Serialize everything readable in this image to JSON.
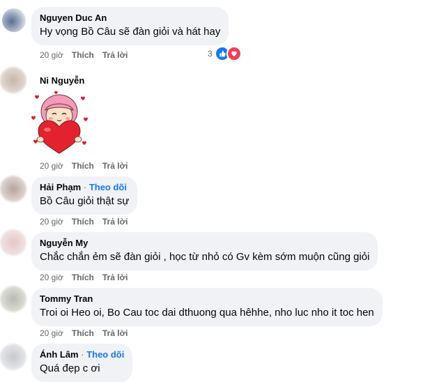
{
  "comments": [
    {
      "author": "Nguyen Duc An",
      "text": "Hy vọng Bồ Câu sẽ đàn giỏi và hát hay",
      "time": "20 giờ",
      "like_label": "Thích",
      "reply_label": "Trả lời",
      "reaction_count": "3",
      "reactions": [
        "like-icon",
        "love-icon"
      ]
    },
    {
      "author": "Ni Nguyễn",
      "sticker": "heart-girl-sticker",
      "time": "20 giờ",
      "like_label": "Thích",
      "reply_label": "Trả lời"
    },
    {
      "author": "Hải Phạm",
      "follow_label": "Theo dõi",
      "text": "Bồ Câu giỏi thật sự",
      "time": "20 giờ",
      "like_label": "Thích",
      "reply_label": "Trả lời"
    },
    {
      "author": "Nguyễn My",
      "text": "Chắc chắn ẻm sẽ đàn giỏi , học từ nhỏ có Gv kèm sớm muộn cũng giỏi",
      "time": "20 giờ",
      "like_label": "Thích",
      "reply_label": "Trả lời"
    },
    {
      "author": "Tommy Tran",
      "text": "Troi oi Heo oi, Bo Cau toc dai dthuong qua hêhhe, nho luc nho it toc hen",
      "time": "20 giờ",
      "like_label": "Thích",
      "reply_label": "Trả lời"
    },
    {
      "author": "Ánh Lâm",
      "follow_label": "Theo dõi",
      "text": "Quá đẹp c ơi"
    }
  ],
  "colors": {
    "bubble": "#f0f2f5",
    "meta": "#65676b",
    "follow": "#1877f2",
    "like": "#1877f2",
    "love": "#f33e58"
  }
}
